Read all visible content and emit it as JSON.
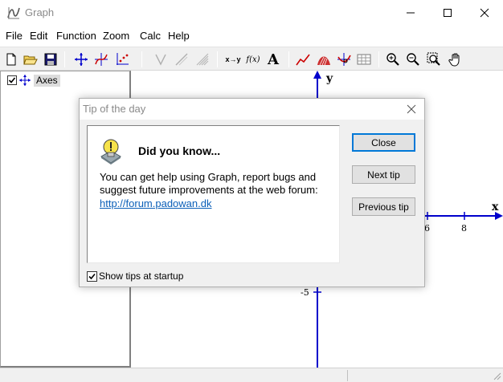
{
  "window": {
    "title": "Graph"
  },
  "menu": [
    "File",
    "Edit",
    "Function",
    "Zoom",
    "Calc",
    "Help"
  ],
  "toolbar": {
    "text_tool_glyph": "A",
    "insert_xy_glyph": "x→y",
    "insert_fx_glyph": "f(x)"
  },
  "tree": {
    "axes_label": "Axes",
    "axes_checked": true
  },
  "graph": {
    "x_axis_label": "x",
    "y_axis_label": "y",
    "tick_labels": {
      "x6": "6",
      "x8": "8",
      "ym5": "-5"
    },
    "axis_color": "#0000cc"
  },
  "dialog": {
    "title": "Tip of the day",
    "heading": "Did you know...",
    "body": "You can get help using Graph, report bugs and suggest future improvements at the web forum:",
    "link": "http://forum.padowan.dk",
    "buttons": {
      "close": "Close",
      "next": "Next tip",
      "previous": "Previous tip"
    },
    "show_tips_label": "Show tips at startup",
    "show_tips_checked": true
  }
}
